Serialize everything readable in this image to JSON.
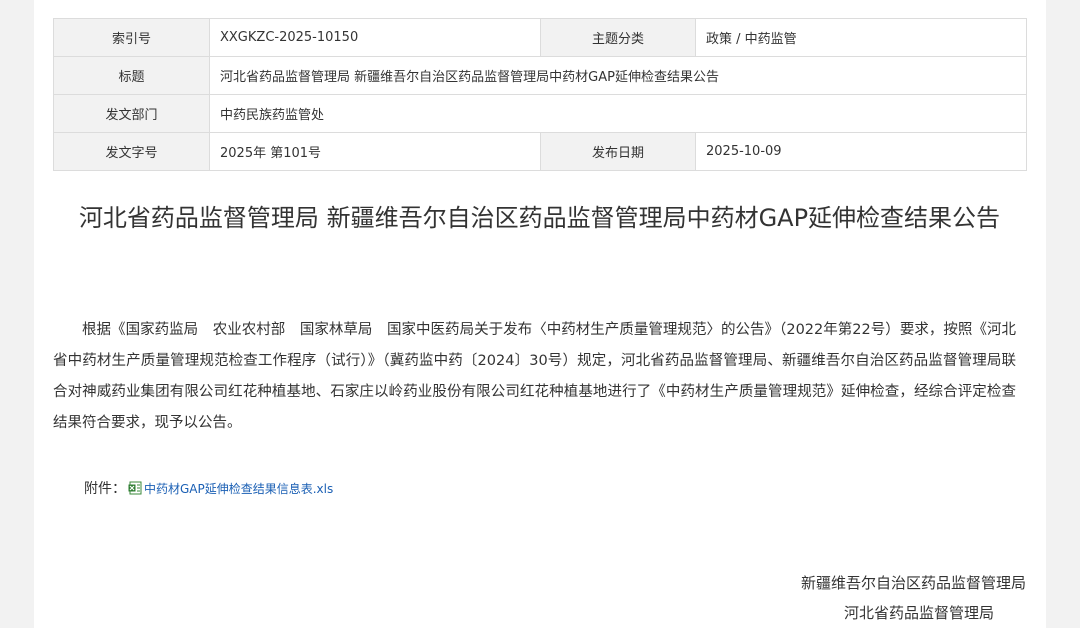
{
  "meta": {
    "index_label": "索引号",
    "index_value": "XXGKZC-2025-10150",
    "category_label": "主题分类",
    "category_value": "政策 / 中药监管",
    "title_label": "标题",
    "title_value": "河北省药品监督管理局 新疆维吾尔自治区药品监督管理局中药材GAP延伸检查结果公告",
    "dept_label": "发文部门",
    "dept_value": "中药民族药监管处",
    "docno_label": "发文字号",
    "docno_value": "2025年 第101号",
    "date_label": "发布日期",
    "date_value": "2025-10-09"
  },
  "article": {
    "title": "河北省药品监督管理局 新疆维吾尔自治区药品监督管理局中药材GAP延伸检查结果公告",
    "body": "根据《国家药监局　农业农村部　国家林草局　国家中医药局关于发布〈中药材生产质量管理规范〉的公告》（2022年第22号）要求，按照《河北省中药材生产质量管理规范检查工作程序（试行）》（冀药监中药〔2024〕30号）规定，河北省药品监督管理局、新疆维吾尔自治区药品监督管理局联合对神威药业集团有限公司红花种植基地、石家庄以岭药业股份有限公司红花种植基地进行了《中药材生产质量管理规范》延伸检查，经综合评定检查结果符合要求，现予以公告。",
    "attachment_label": "附件：",
    "attachment_name": "中药材GAP延伸检查结果信息表.xls",
    "sign_1": "新疆维吾尔自治区药品监督管理局",
    "sign_2": "河北省药品监督管理局"
  }
}
